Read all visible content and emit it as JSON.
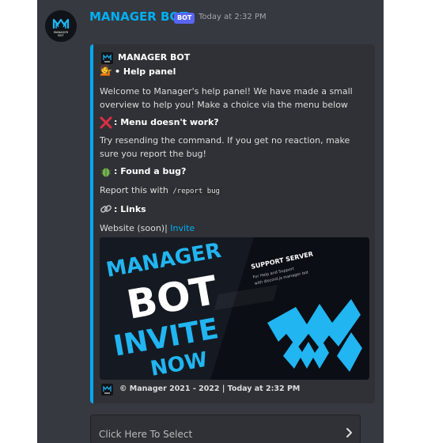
{
  "message": {
    "author": "MANAGER BOT",
    "tag": "BOT",
    "timestamp": "Today at 2:32 PM",
    "avatar_text": "MANAGER BOT"
  },
  "embed": {
    "accent_color": "#03a9f4",
    "author_name": "MANAGER BOT",
    "title_icon": "person-tipping-hand-emoji",
    "title": "• Help panel",
    "description": "Welcome to Manager's help panel! We have made a small overview to help you! Make a choice via the menu below",
    "fields": [
      {
        "icon": "cross-mark-emoji",
        "name": ": Menu doesn't work?",
        "value": "Try resending the command. If you get no reaction, make sure you report the bug!"
      },
      {
        "icon": "bug-emoji",
        "name": ": Found a bug?",
        "value_prefix": "Report this with ",
        "value_code": "/report bug"
      },
      {
        "icon": "link-emoji",
        "name": ": Links",
        "value_prefix": "Website (soon)| ",
        "value_link": "Invite"
      }
    ],
    "image": {
      "line1": "MANAGER",
      "line2": "BOT",
      "line3": "INVITE",
      "line4": "NOW",
      "side_title": "SUPPORT SERVER",
      "side_line1": "For Help and Support",
      "side_line2": "with discord.js manager bot"
    },
    "footer": "© Manager 2021 - 2022 | Today at 2:32 PM"
  },
  "select_menu": {
    "placeholder": "Click Here To Select",
    "icon": "chevron-right-icon"
  }
}
